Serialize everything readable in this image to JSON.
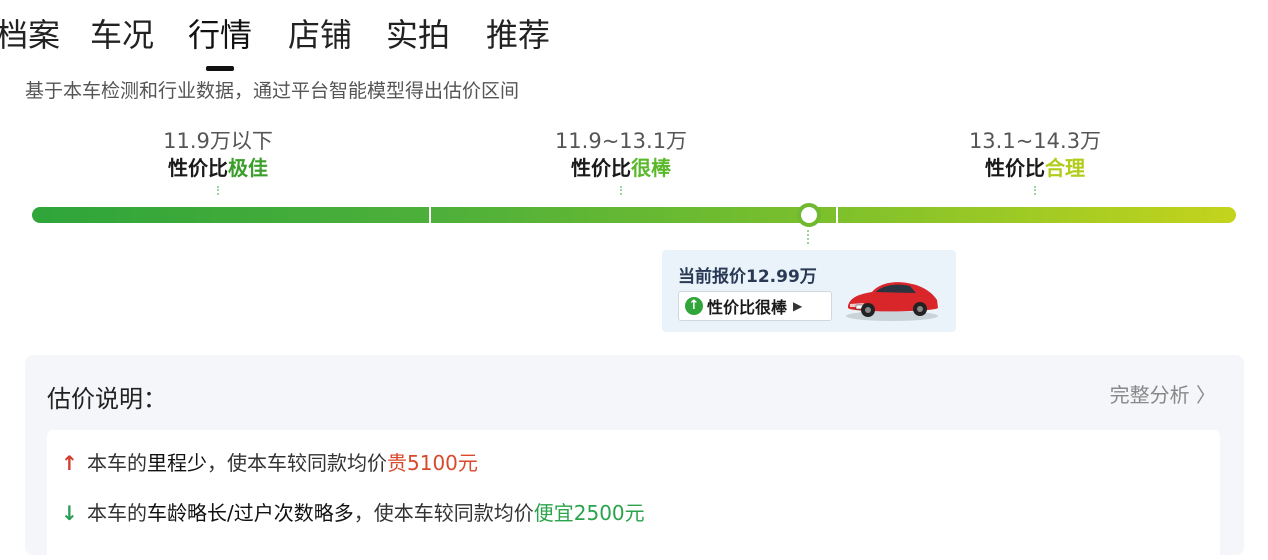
{
  "tabs": [
    {
      "label": "档案"
    },
    {
      "label": "车况"
    },
    {
      "label": "行情"
    },
    {
      "label": "店铺"
    },
    {
      "label": "实拍"
    },
    {
      "label": "推荐"
    }
  ],
  "active_tab": "行情",
  "subtitle": "基于本车检测和行业数据，通过平台智能模型得出估价区间",
  "ranges": [
    {
      "price": "11.9万以下",
      "prefix": "性价比",
      "level": "极佳",
      "color": "#3a9f2a"
    },
    {
      "price": "11.9~13.1万",
      "prefix": "性价比",
      "level": "很棒",
      "color": "#5bb82b"
    },
    {
      "price": "13.1~14.3万",
      "prefix": "性价比",
      "level": "合理",
      "color": "#b3cc1b"
    }
  ],
  "price_bar": {
    "min": 10.7,
    "max": 15.5,
    "current": 12.99,
    "colors": [
      "#2fa53a",
      "#c4d41c"
    ]
  },
  "price_card": {
    "text": "当前报价12.99万",
    "badge": "性价比很棒",
    "car_icon": "red-sedan-image",
    "badge_icon": "arrow-up-circle-icon"
  },
  "explanation": {
    "title": "估价说明：",
    "link": "完整分析 〉",
    "reasons": [
      {
        "direction": "up",
        "arrow": "↑",
        "pre": "本车的",
        "factor": "里程少",
        "mid": "，使本车较同款均价",
        "verdict": "贵5100元"
      },
      {
        "direction": "down",
        "arrow": "↓",
        "pre": "本车的",
        "factor": "车龄略长/过户次数略多",
        "mid": "，使本车较同款均价",
        "verdict": "便宜2500元"
      }
    ]
  }
}
